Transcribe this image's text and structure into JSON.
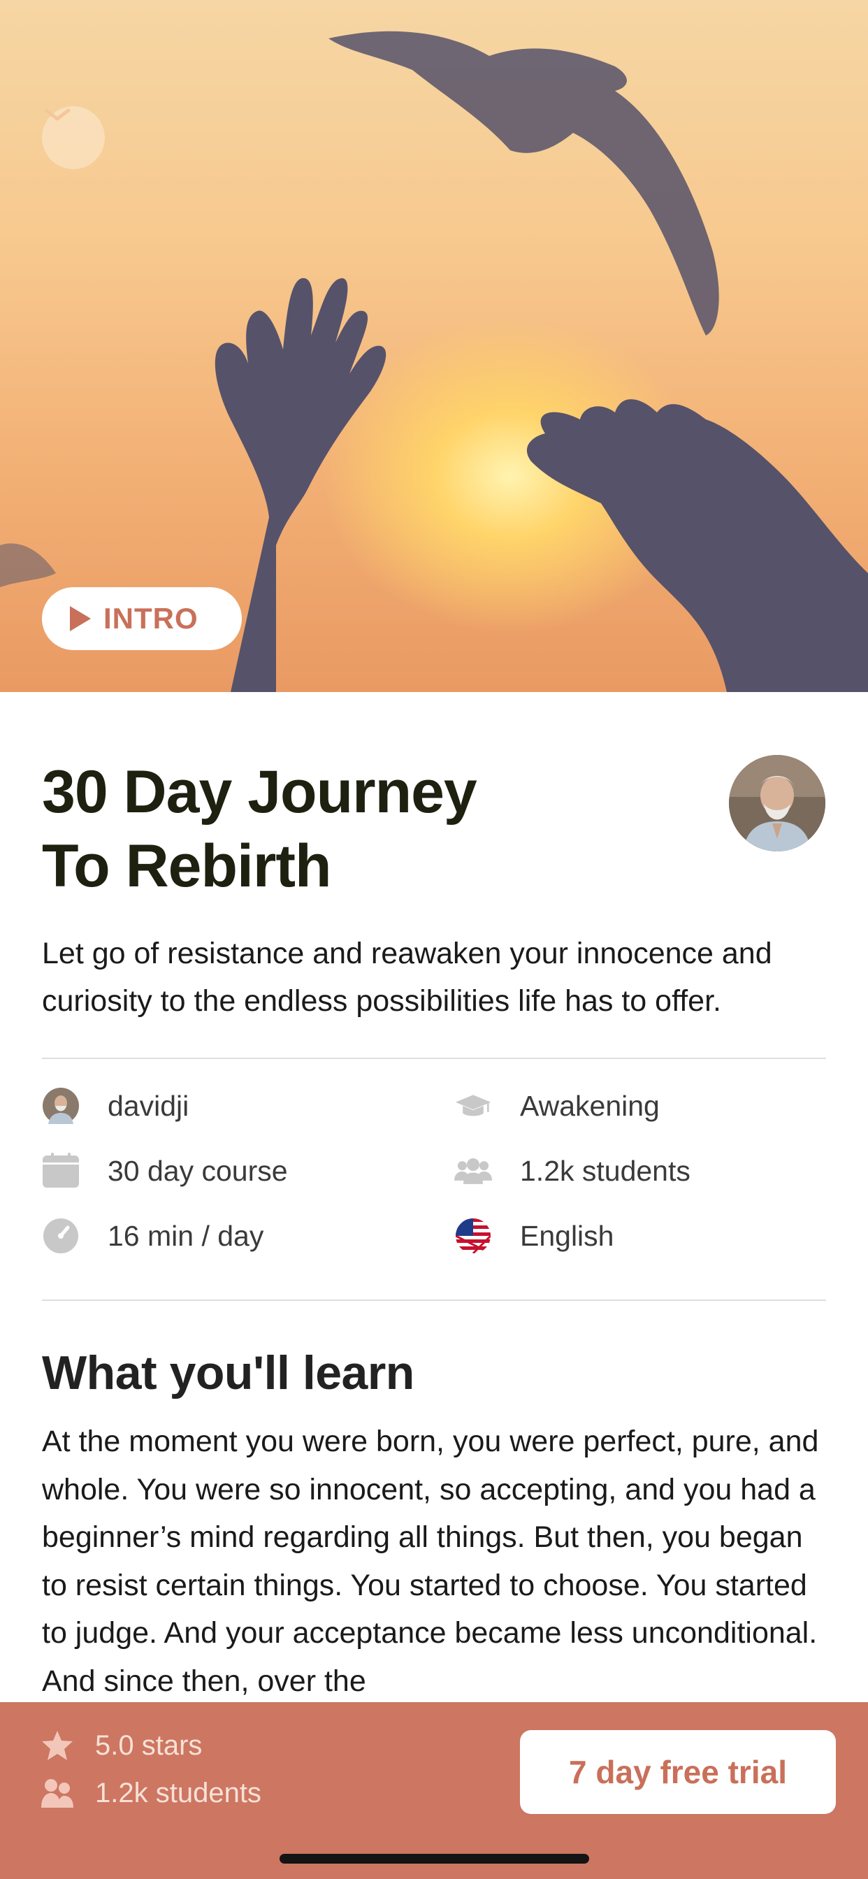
{
  "hero": {
    "intro_label": "INTRO"
  },
  "course": {
    "title_line1": "30 Day Journey",
    "title_line2": "To Rebirth",
    "description": "Let go of resistance and reawaken your innocence and curiosity to the endless possibilities life has to offer."
  },
  "meta": {
    "teacher": "davidji",
    "category": "Awakening",
    "duration": "30 day course",
    "students": "1.2k students",
    "session_length": "16 min / day",
    "language": "English"
  },
  "learn": {
    "heading": "What you'll learn",
    "body": "At the moment you were born, you were perfect, pure, and whole. You were so innocent, so accepting, and you had a beginner’s mind regarding all things. But then, you began to resist certain things. You started to choose. You started to judge. And your acceptance became less unconditional. And since then, over the"
  },
  "footer": {
    "rating": "5.0 stars",
    "students": "1.2k students",
    "cta_label": "7 day free trial"
  },
  "colors": {
    "accent": "#cd7661",
    "title": "#1e2010"
  },
  "icons": [
    "chevron-down-icon",
    "play-icon",
    "graduation-cap-icon",
    "calendar-icon",
    "users-icon",
    "clock-icon",
    "us-flag-icon",
    "star-icon"
  ]
}
